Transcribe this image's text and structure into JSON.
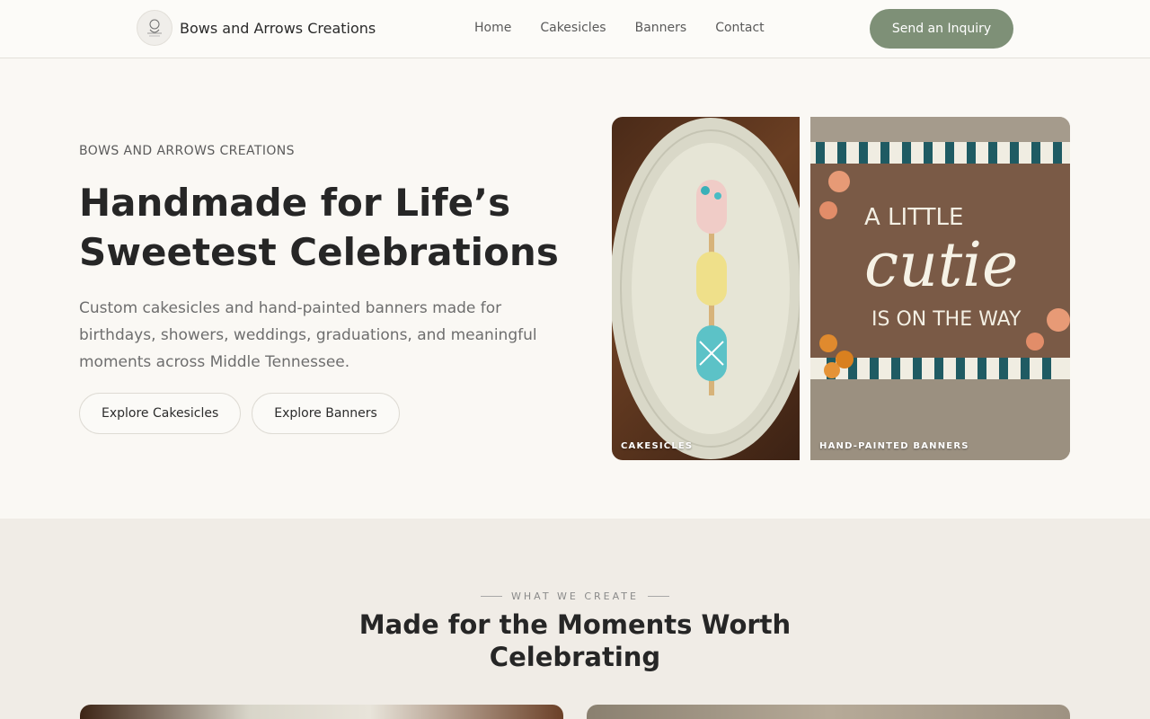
{
  "nav": {
    "brand_name": "Bows and Arrows Creations",
    "logo_icon": "brand-logo",
    "links": [
      "Home",
      "Cakesicles",
      "Banners",
      "Contact"
    ],
    "cta_label": "Send an Inquiry"
  },
  "hero": {
    "eyebrow": "BOWS AND ARROWS CREATIONS",
    "title_line1": "Handmade for Life’s",
    "title_line2": "Sweetest Celebrations",
    "description": "Custom cakesicles and hand-painted banners made for birthdays, showers, weddings, graduations, and meaningful moments across Middle Tennessee.",
    "buttons": [
      "Explore Cakesicles",
      "Explore Banners"
    ],
    "images": [
      {
        "label": "CAKESICLES"
      },
      {
        "label": "HAND-PAINTED BANNERS"
      }
    ],
    "banner_text": {
      "line1": "A LITTLE",
      "line2": "cutie",
      "line3": "IS ON THE WAY"
    }
  },
  "section2": {
    "eyebrow": "WHAT WE CREATE",
    "title_line1": "Made for the Moments Worth",
    "title_line2": "Celebrating"
  },
  "colors": {
    "accent": "#7e9077",
    "background": "#faf8f4",
    "section_bg": "#f0ece6",
    "text": "#262626"
  }
}
